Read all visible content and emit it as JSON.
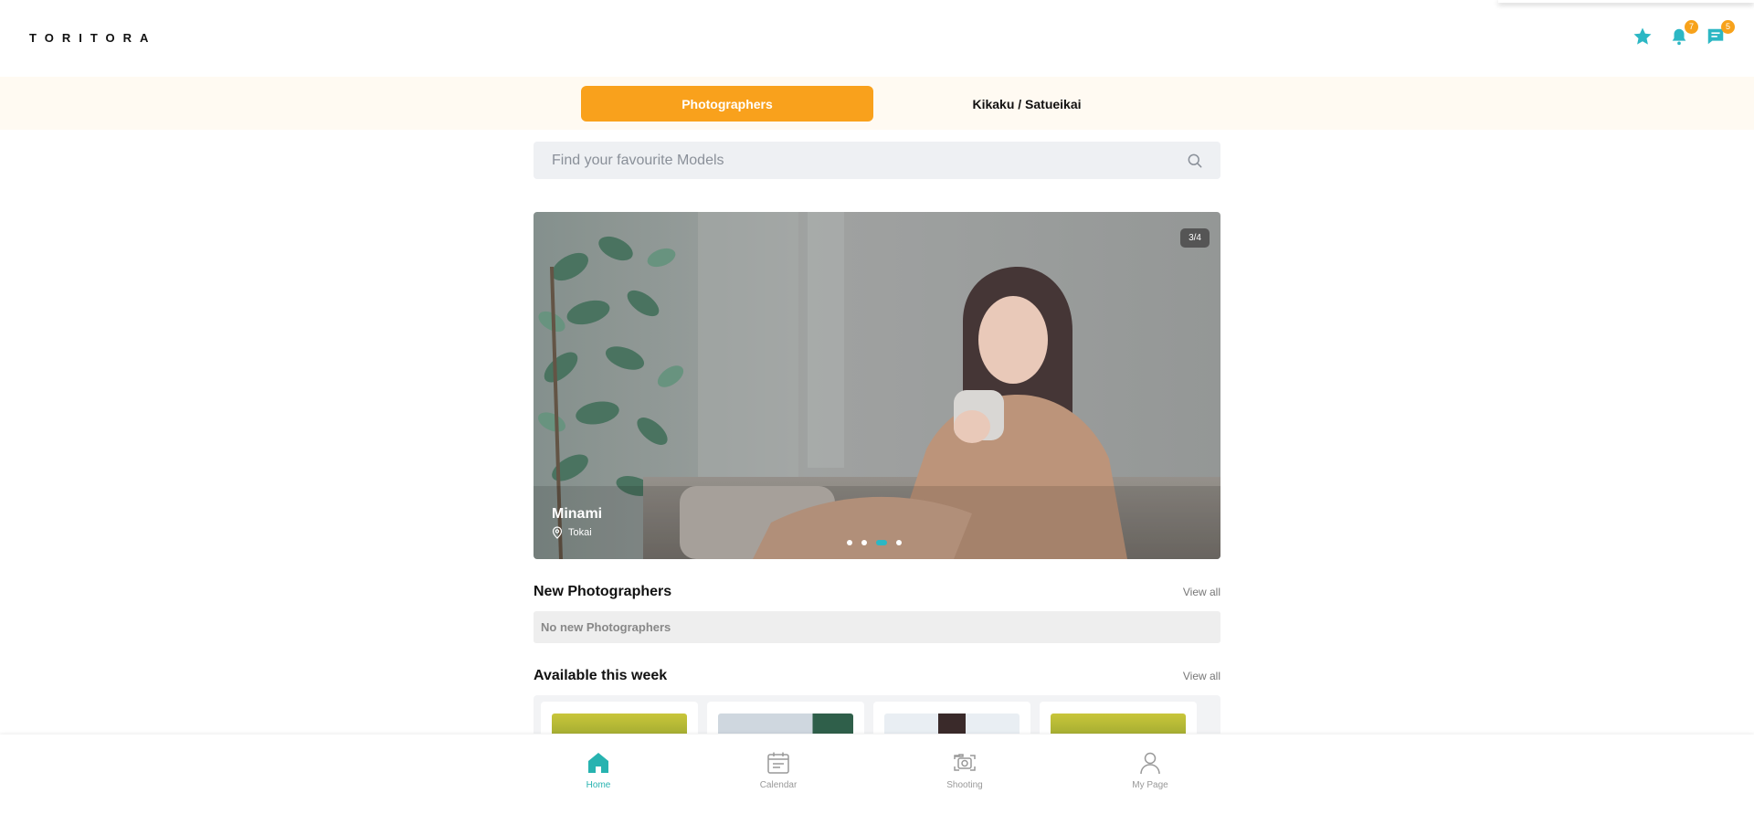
{
  "header": {
    "logo": "TORITORA",
    "icons": [
      {
        "name": "star-icon",
        "badge": null
      },
      {
        "name": "bell-icon",
        "badge": "7"
      },
      {
        "name": "message-icon",
        "badge": "5"
      }
    ],
    "accent_color": "#2cb7c4"
  },
  "tabs": {
    "active_label": "Photographers",
    "inactive_label": "Kikaku / Satueikai",
    "active_color": "#f9a11c"
  },
  "search": {
    "placeholder": "Find your favourite Models"
  },
  "carousel": {
    "counter": "3/4",
    "name": "Minami",
    "location": "Tokai",
    "slide_count": 4,
    "active_index": 2
  },
  "new_photographers": {
    "title": "New Photographers",
    "view_all": "View all",
    "empty_text": "No new Photographers"
  },
  "available_week": {
    "title": "Available this week",
    "view_all": "View all"
  },
  "bottom_nav": {
    "items": [
      {
        "label": "Home",
        "icon": "home-icon",
        "active": true
      },
      {
        "label": "Calendar",
        "icon": "calendar-icon",
        "active": false
      },
      {
        "label": "Shooting",
        "icon": "camera-icon",
        "active": false
      },
      {
        "label": "My Page",
        "icon": "user-icon",
        "active": false
      }
    ],
    "active_color": "#27b3b0"
  }
}
